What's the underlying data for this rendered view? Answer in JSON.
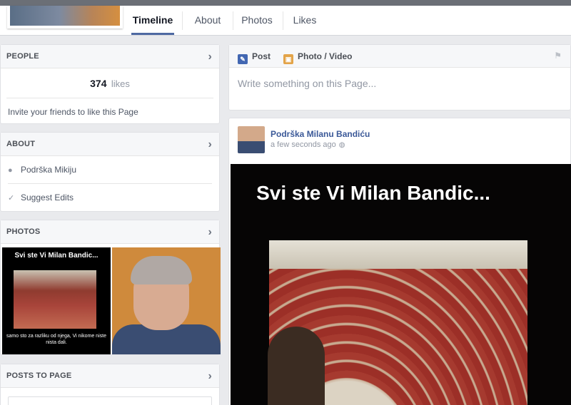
{
  "tabs": [
    {
      "label": "Timeline",
      "active": true
    },
    {
      "label": "About",
      "active": false
    },
    {
      "label": "Photos",
      "active": false
    },
    {
      "label": "Likes",
      "active": false
    }
  ],
  "people": {
    "heading": "PEOPLE",
    "likes_count": "374",
    "likes_label": "likes",
    "invite_text": "Invite your friends to like this Page"
  },
  "about": {
    "heading": "ABOUT",
    "items": [
      {
        "label": "Podrška Mikiju",
        "icon": "info-icon"
      },
      {
        "label": "Suggest Edits",
        "icon": "check-icon"
      }
    ]
  },
  "photos": {
    "heading": "PHOTOS",
    "thumb1": {
      "title": "Svi ste Vi Milan Bandic...",
      "caption": "samo sto za razliku od njega, Vi nikome niste nista dali."
    }
  },
  "posts_to_page": {
    "heading": "POSTS TO PAGE"
  },
  "composer": {
    "post_label": "Post",
    "photo_video_label": "Photo / Video",
    "placeholder": "Write something on this Page..."
  },
  "post": {
    "author": "Podrška Milanu Bandiću",
    "time": "a few seconds ago",
    "image_title": "Svi ste Vi Milan Bandic..."
  },
  "colors": {
    "link": "#3b5998",
    "active_tab_border": "#4e69a2",
    "background": "#e9eaed"
  }
}
